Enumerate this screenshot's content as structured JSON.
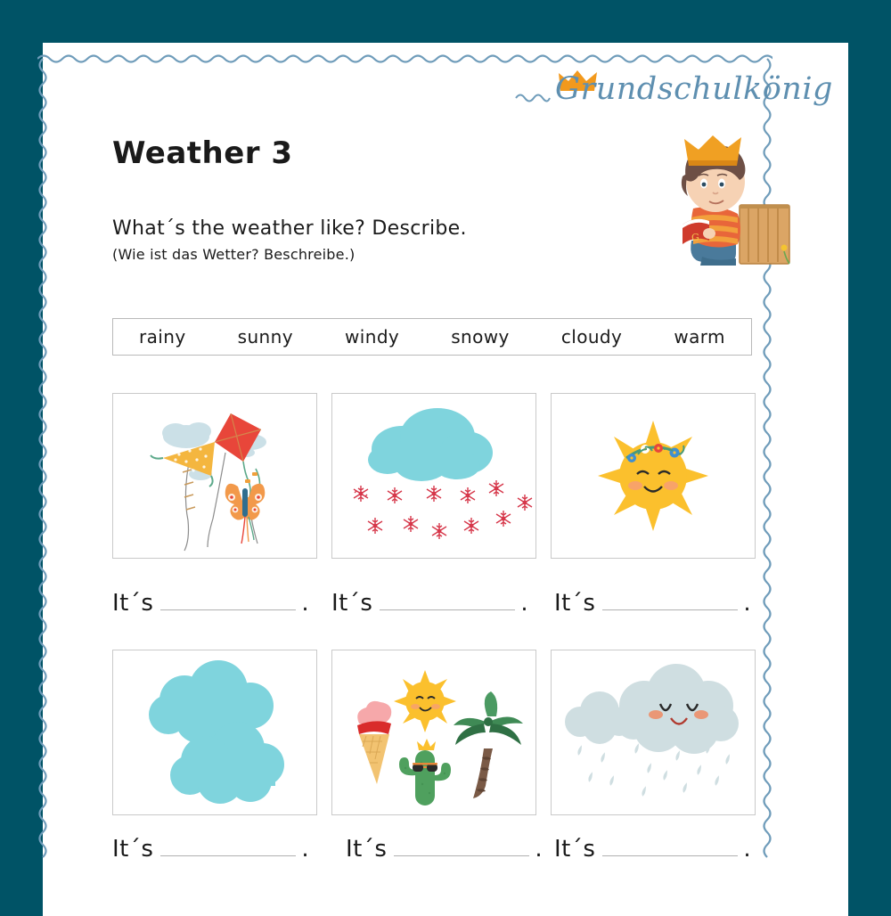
{
  "frame": {
    "background_color": "#005366",
    "sheet_color": "#ffffff",
    "border_color": "#6f9cba"
  },
  "logo": {
    "brand_name": "Grundschulkönig",
    "text_color": "#5e8fb0",
    "crown_color": "#f2991d",
    "crown_icon": "crown-icon",
    "squiggle_icon": "wave-squiggle-icon"
  },
  "mascot": {
    "name": "king-boy-reading-mascot",
    "crown_color": "#f0a023",
    "hair_color": "#6d4f45",
    "shirt_colors": [
      "#e8663a",
      "#f2a03c"
    ],
    "pants_color": "#3f6e8c",
    "book_color": "#cf3b2c",
    "fence_color": "#d9a05b"
  },
  "header": {
    "title": "Weather 3",
    "prompt_english": "What´s the weather like? Describe.",
    "prompt_german": "(Wie ist das Wetter? Beschreibe.)"
  },
  "wordbank": {
    "words": [
      "rainy",
      "sunny",
      "windy",
      "snowy",
      "cloudy",
      "warm"
    ]
  },
  "exercises": [
    {
      "index": 1,
      "picture": "kites-flying-illustration",
      "answer_prefix": "It´s",
      "answer_value": "",
      "answer_suffix": "."
    },
    {
      "index": 2,
      "picture": "cloud-with-snowflakes-illustration",
      "answer_prefix": "It´s",
      "answer_value": "",
      "answer_suffix": "."
    },
    {
      "index": 3,
      "picture": "smiling-sun-with-flower-crown-illustration",
      "answer_prefix": "It´s",
      "answer_value": "",
      "answer_suffix": "."
    },
    {
      "index": 4,
      "picture": "two-blue-clouds-illustration",
      "answer_prefix": "It´s",
      "answer_value": "",
      "answer_suffix": "."
    },
    {
      "index": 5,
      "picture": "summer-icecream-sun-cactus-palm-illustration",
      "answer_prefix": "It´s",
      "answer_value": "",
      "answer_suffix": "."
    },
    {
      "index": 6,
      "picture": "smiling-rain-cloud-illustration",
      "answer_prefix": "It´s",
      "answer_value": "",
      "answer_suffix": "."
    }
  ],
  "colors": {
    "cloud_turquoise": "#7fd4dd",
    "cloud_gray_blue": "#cfdee1",
    "sun_yellow": "#fbc02d",
    "snowflake_red": "#d6374a",
    "kite_red": "#e8463a",
    "kite_yellow": "#f4b63f",
    "palm_green": "#3f8a55",
    "text_black": "#1a1a1a",
    "rule_gray": "#b0b0b0"
  }
}
